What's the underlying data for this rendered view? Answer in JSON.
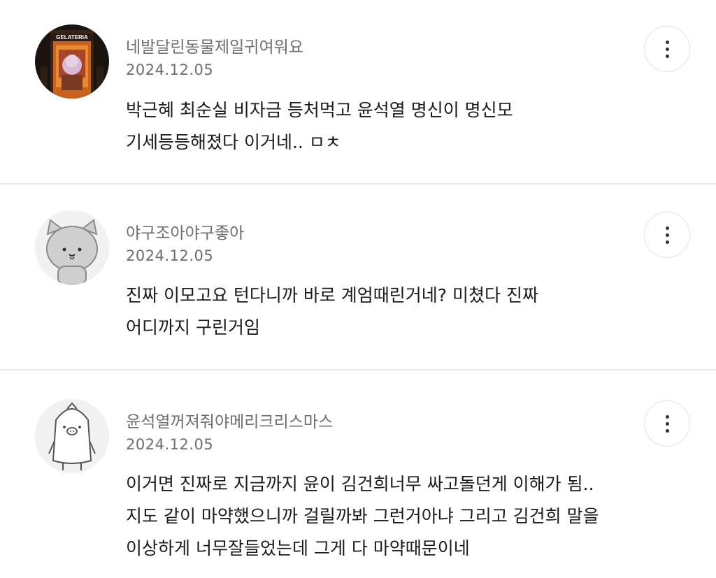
{
  "comments": [
    {
      "username": "네발달린동물제일귀여워요",
      "date": "2024.12.05",
      "lines": [
        "박근혜 최순실 비자금 등처먹고 윤석열 명신이 명신모",
        "기세등등해졌다 이거네.. ㅁㅊ"
      ],
      "avatar_icon": "gelateria-photo-avatar",
      "avatar_sign_text": "GELATERIA"
    },
    {
      "username": "야구조아야구좋아",
      "date": "2024.12.05",
      "lines": [
        "진짜 이모고요 턴다니까 바로 계엄때린거네? 미쳤다 진짜",
        "어디까지 구린거임"
      ],
      "avatar_icon": "cat-avatar"
    },
    {
      "username": "윤석열꺼져줘야메리크리스마스",
      "date": "2024.12.05",
      "lines": [
        "이거면 진짜로 지금까지 윤이 김건희너무 싸고돌던게 이해가 됨..",
        "지도 같이 마약했으니까 걸릴까봐 그런거아냐 그리고 김건희 말을",
        "이상하게 너무잘들었는데 그게 다 마약때문이네"
      ],
      "avatar_icon": "pig-character-avatar"
    }
  ],
  "more_icon": "more-vertical-icon"
}
